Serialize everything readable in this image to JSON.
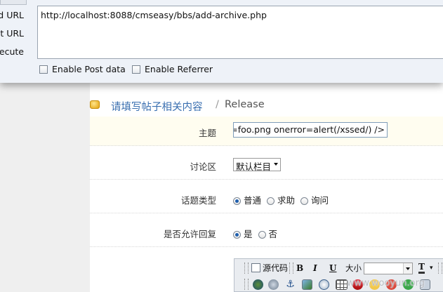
{
  "hackbar": {
    "actions": [
      "Load URL",
      "Split URL",
      "Execute"
    ],
    "actions_visible": [
      "d URL",
      "it URL",
      "ecute"
    ],
    "url_value": "http://localhost:8088/cmseasy/bbs/add-archive.php",
    "enable_post_label": "Enable Post data",
    "enable_referrer_label": "Enable Referrer"
  },
  "page": {
    "title_cn": "请填写帖子相关内容",
    "title_sep": "/",
    "title_en": "Release",
    "subject": {
      "label": "主题",
      "value": "g src=foo.png onerror=alert(/xssed/) />"
    },
    "forum": {
      "label": "讨论区",
      "selected": "默认栏目"
    },
    "topic_type": {
      "label": "话题类型",
      "options": [
        "普通",
        "求助",
        "询问"
      ],
      "selected_index": 0
    },
    "allow_reply": {
      "label": "是否允许回复",
      "options": [
        "是",
        "否"
      ],
      "selected_index": 0
    }
  },
  "editor": {
    "source_label": "源代码",
    "bold_label": "B",
    "italic_label": "I",
    "underline_label": "U",
    "size_label": "大小",
    "font_color_label": "T"
  },
  "watermark": "www.wooyun.org"
}
